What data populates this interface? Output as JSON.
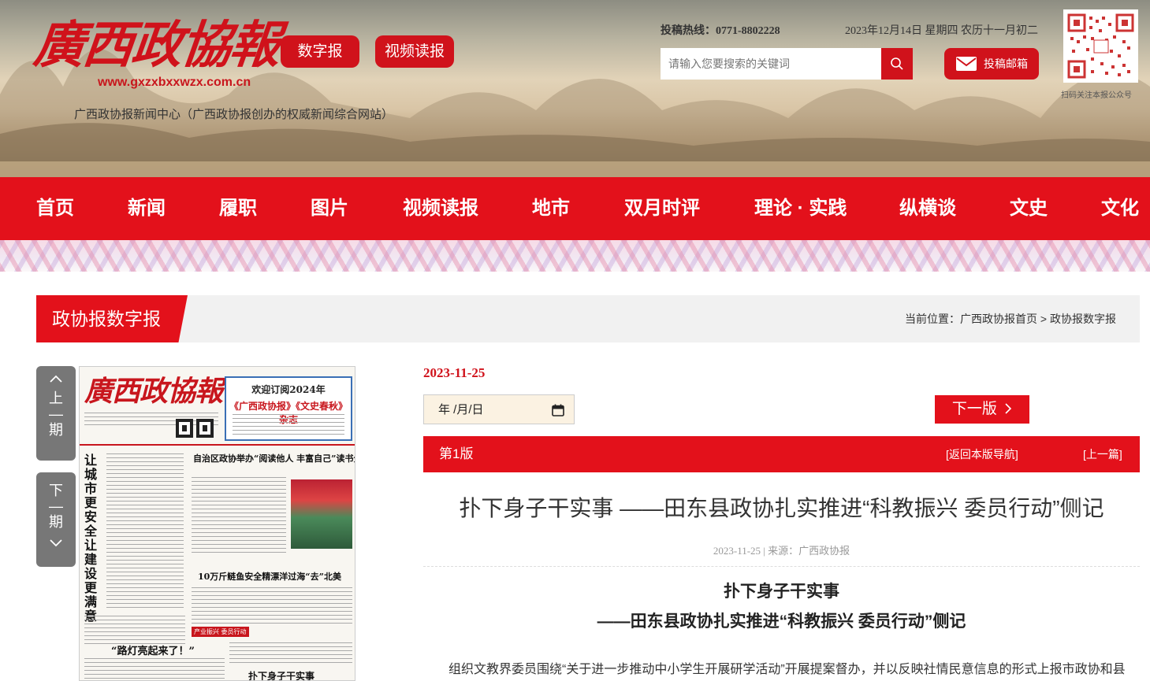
{
  "header": {
    "logo_text": "廣西政協報",
    "logo_url": "www.gxzxbxxwzx.com.cn",
    "slogan": "广西政协报新闻中心（广西政协报创办的权威新闻综合网站）",
    "btn_digital": "数字报",
    "btn_video": "视频读报",
    "hotline": "投稿热线：0771-8802228",
    "date_line": "2023年12月14日 星期四 农历十一月初二",
    "search_placeholder": "请输入您要搜索的关键词",
    "mail_label": "投稿邮箱",
    "qr_label": "扫码关注本报公众号"
  },
  "nav": {
    "items": [
      "首页",
      "新闻",
      "履职",
      "图片",
      "视频读报",
      "地市",
      "双月时评",
      "理论 · 实践",
      "纵横谈",
      "文史",
      "文化"
    ]
  },
  "section": {
    "title": "政协报数字报",
    "breadcrumb": "当前位置：广西政协报首页 > 政协报数字报"
  },
  "side": {
    "prev": [
      "上",
      "期"
    ],
    "next": [
      "下",
      "期"
    ]
  },
  "paper": {
    "logo": "廣西政協報",
    "ad_line1": "欢迎订阅2024年",
    "ad_line2": "《广西政协报》《文史春秋》杂志",
    "vertical_headline": "让城市更安全 让建设更满意",
    "headline1": "自治区政协举办“阅读他人 丰富自己”读书分享会",
    "headline2": "10万斤鲢鱼安全精漂洋过海“去”北美",
    "headline3": "“路灯亮起来了！”",
    "headline4": "扑下身子干实事",
    "tag": "产业振兴 委员行动"
  },
  "content": {
    "issue_date": "2023-11-25",
    "date_input": "年 /月/日",
    "next_edition": "下一版",
    "edition_name": "第1版",
    "back_nav": "[返回本版导航]",
    "prev_article": "[上一篇]",
    "title": "扑下身子干实事 ——田东县政协扎实推进“科教振兴 委员行动”侧记",
    "meta": "2023-11-25 | 来源：广西政协报",
    "subtitle1": "扑下身子干实事",
    "subtitle2": "——田东县政协扎实推进“科教振兴 委员行动”侧记",
    "body": "组织文教界委员围绕“关于进一步推动中小学生开展研学活动”开展提案督办，并以反映社情民意信息的形式上报市政协和县"
  },
  "colors": {
    "brand_red": "#e3111b",
    "accent_red": "#d0121b",
    "side_gray": "#777777"
  }
}
